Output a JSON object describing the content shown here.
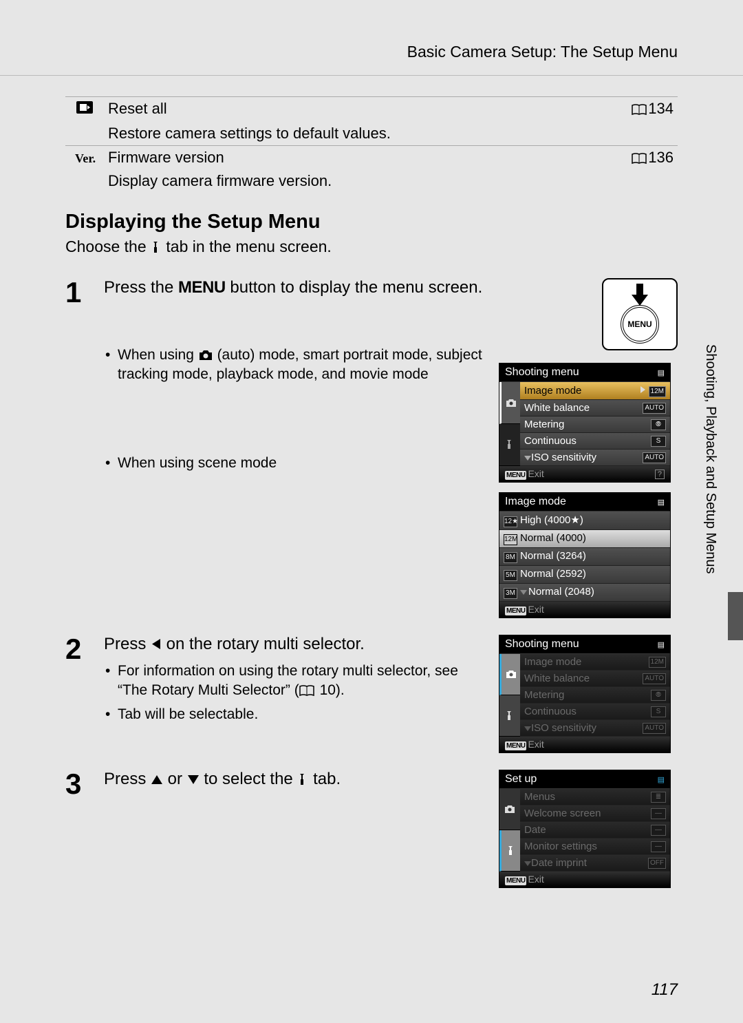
{
  "header": {
    "title": "Basic Camera Setup: The Setup Menu"
  },
  "settings": {
    "reset": {
      "label": "Reset all",
      "page": "134",
      "desc": "Restore camera settings to default values."
    },
    "firmware": {
      "label": "Firmware version",
      "page": "136",
      "desc": "Display camera firmware version."
    }
  },
  "section": {
    "heading": "Displaying the Setup Menu",
    "intro_before": "Choose the ",
    "intro_after": " tab in the menu screen."
  },
  "steps": {
    "s1": {
      "num": "1",
      "title_before": "Press the ",
      "title_menu": "MENU",
      "title_after": " button to display the menu screen.",
      "bullet1": "When using ",
      "bullet1_after": " (auto) mode, smart portrait mode, subject tracking mode, playback mode, and movie mode",
      "bullet2": "When using scene mode",
      "menu_btn_label": "MENU"
    },
    "s2": {
      "num": "2",
      "title_before": "Press ",
      "title_after": " on the rotary multi selector.",
      "bullet1_before": "For information on using the rotary multi selector, see “The Rotary Multi Selector” (",
      "bullet1_page": " 10).",
      "bullet2": "Tab will be selectable."
    },
    "s3": {
      "num": "3",
      "title_before": "Press ",
      "title_mid": " or ",
      "title_after": " to select the ",
      "title_end": " tab."
    }
  },
  "screens": {
    "shooting1": {
      "title": "Shooting menu",
      "items": [
        "Image mode",
        "White balance",
        "Metering",
        "Continuous",
        "ISO sensitivity"
      ],
      "badges": [
        "12M",
        "AUTO",
        "⦾",
        "S",
        "AUTO"
      ],
      "exit": "Exit"
    },
    "imagemode": {
      "title": "Image mode",
      "items": [
        "High (4000★)",
        "Normal (4000)",
        "Normal (3264)",
        "Normal (2592)",
        "Normal (2048)"
      ],
      "icons": [
        "12★",
        "12M",
        "8M",
        "5M",
        "3M"
      ],
      "exit": "Exit"
    },
    "shooting2": {
      "title": "Shooting menu",
      "items": [
        "Image mode",
        "White balance",
        "Metering",
        "Continuous",
        "ISO sensitivity"
      ],
      "badges": [
        "12M",
        "AUTO",
        "⦾",
        "S",
        "AUTO"
      ],
      "exit": "Exit"
    },
    "setup": {
      "title": "Set up",
      "items": [
        "Menus",
        "Welcome screen",
        "Date",
        "Monitor settings",
        "Date imprint"
      ],
      "badges": [
        "≣",
        "—",
        "—",
        "—",
        "OFF"
      ],
      "exit": "Exit"
    }
  },
  "side_label": "Shooting, Playback and Setup Menus",
  "page_number": "117"
}
